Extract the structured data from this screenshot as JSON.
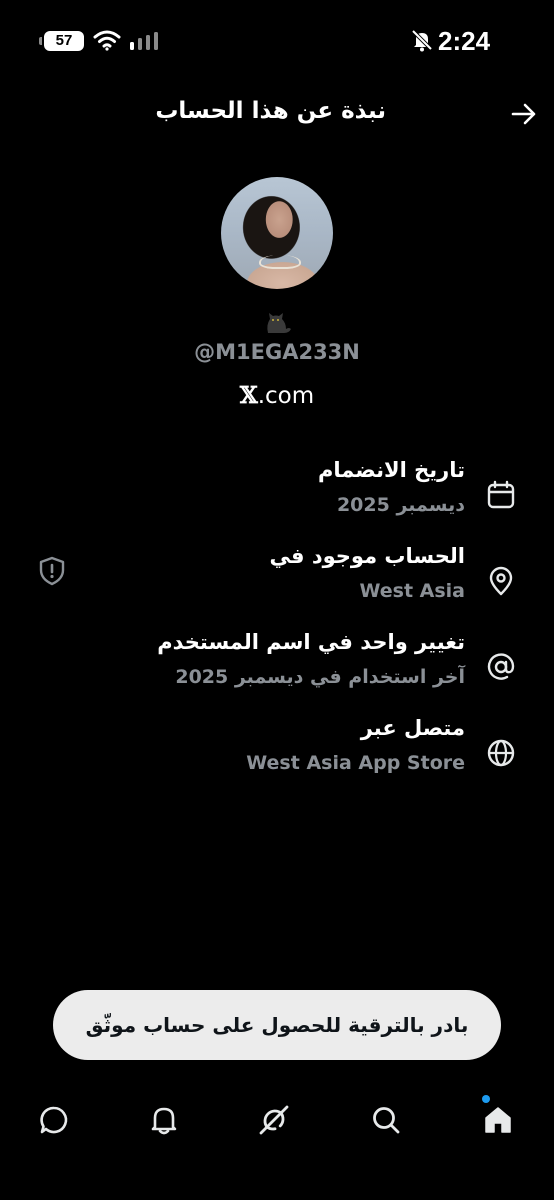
{
  "status_bar": {
    "battery": "57",
    "time": "2:24",
    "icons": [
      "battery-icon",
      "wifi-icon",
      "signal-icon",
      "bell-muted-icon"
    ]
  },
  "header": {
    "title": "نبذة عن هذا الحساب",
    "back_icon": "arrow-icon"
  },
  "profile": {
    "emoji": "🐈‍⬛",
    "handle": "@M1EGA233N",
    "site_x": "𝕏",
    "site_rest": ".com"
  },
  "info_rows": [
    {
      "title": "تاريخ الانضمام",
      "subtitle": "ديسمبر 2025",
      "icon": "calendar-icon"
    },
    {
      "title": "الحساب موجود في",
      "subtitle": "West Asia",
      "icon": "location-pin-icon",
      "extra_icon": "shield-icon"
    },
    {
      "title": "تغيير واحد في اسم المستخدم",
      "subtitle": "آخر استخدام في ديسمبر 2025",
      "icon": "at-sign-icon"
    },
    {
      "title": "متصل عبر",
      "subtitle": "West Asia App Store",
      "icon": "globe-icon"
    }
  ],
  "upgrade": {
    "label": "بادر بالترقية للحصول على حساب موثّق"
  },
  "bottom_nav": [
    {
      "name": "messages",
      "icon": "chat-bubble-icon"
    },
    {
      "name": "notifications",
      "icon": "bell-icon"
    },
    {
      "name": "grok",
      "icon": "grok-icon"
    },
    {
      "name": "search",
      "icon": "search-icon"
    },
    {
      "name": "home",
      "icon": "home-icon",
      "active": true
    }
  ],
  "colors": {
    "background": "#000000",
    "primary_text": "#e7e9ea",
    "secondary_text": "#8b9096",
    "accent": "#1d9bf0",
    "banner_bg": "#ececec"
  }
}
